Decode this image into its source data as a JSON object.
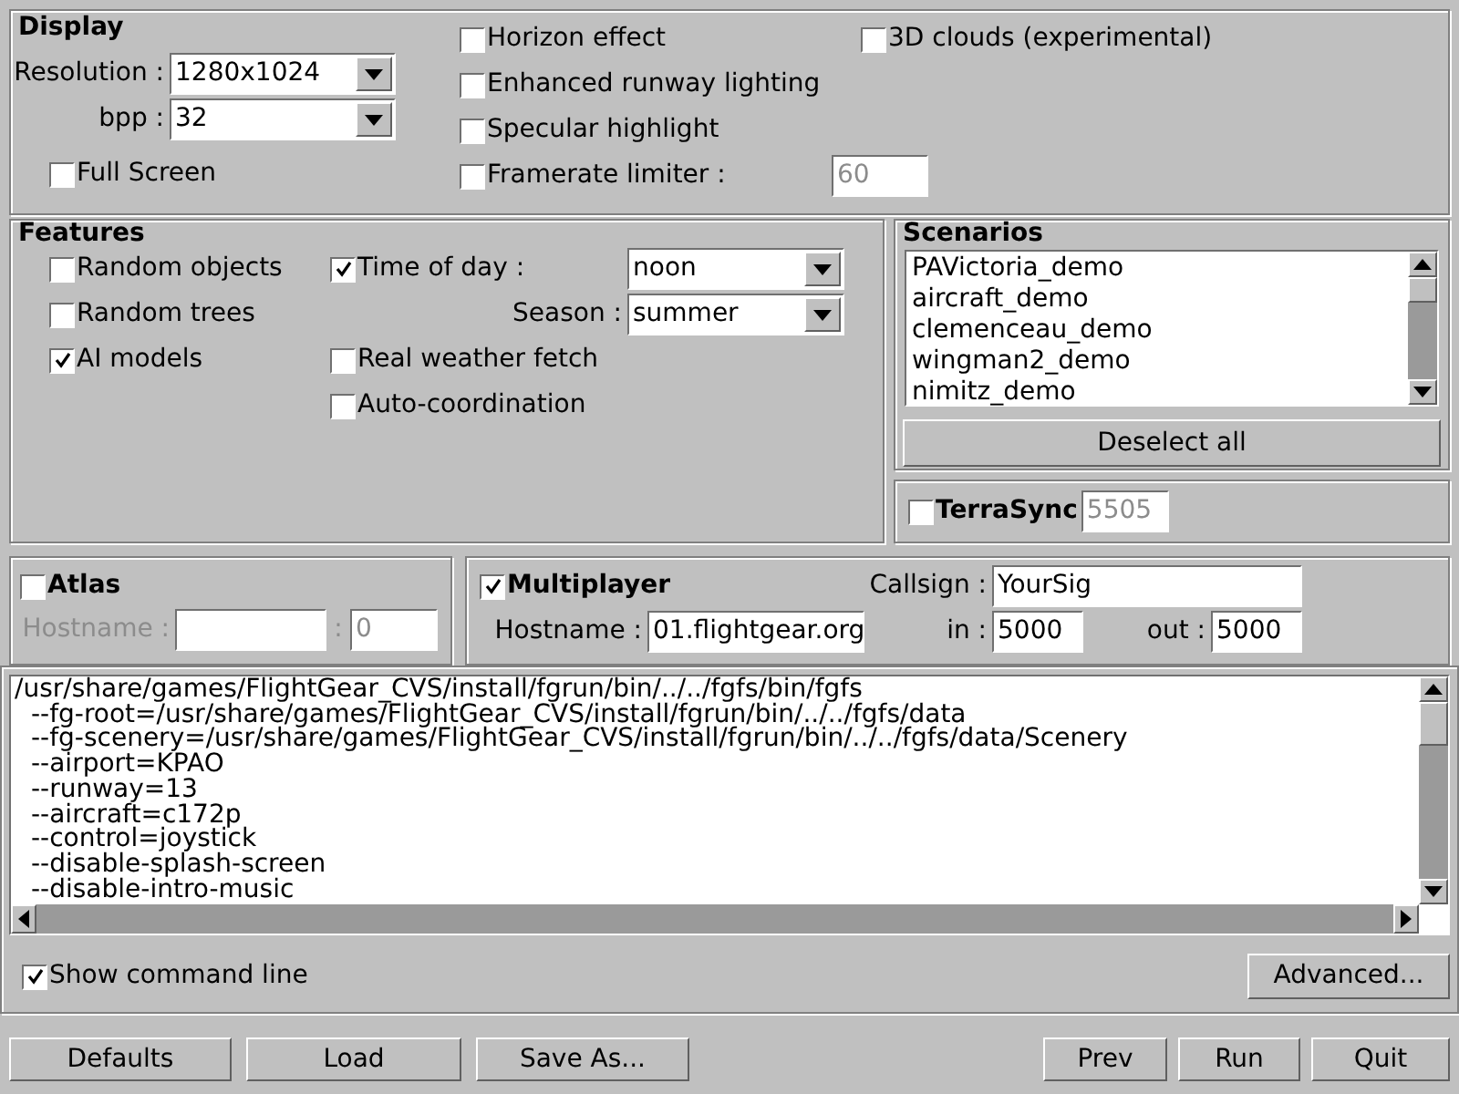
{
  "display": {
    "title": "Display",
    "resolution": {
      "label": "Resolution :",
      "value": "1280x1024"
    },
    "bpp": {
      "label": "bpp :",
      "value": "32"
    },
    "full_screen": {
      "label": "Full Screen",
      "checked": false
    },
    "options": [
      {
        "label": "Horizon effect",
        "checked": false
      },
      {
        "label": "Enhanced runway lighting",
        "checked": false
      },
      {
        "label": "Specular highlight",
        "checked": false
      }
    ],
    "framerate_limiter": {
      "label": "Framerate limiter :",
      "checked": false,
      "value": "60",
      "disabled": true
    },
    "clouds_3d": {
      "label": "3D clouds (experimental)",
      "checked": false
    }
  },
  "features": {
    "title": "Features",
    "options": [
      {
        "label": "Random objects",
        "checked": false
      },
      {
        "label": "Random trees",
        "checked": false
      },
      {
        "label": "AI models",
        "checked": true
      }
    ],
    "time_of_day": {
      "label": "Time of day :",
      "checked": true,
      "value": "noon"
    },
    "season": {
      "label": "Season :",
      "value": "summer"
    },
    "extra_options": [
      {
        "label": "Real weather fetch",
        "checked": false
      },
      {
        "label": "Auto-coordination",
        "checked": false
      }
    ]
  },
  "scenarios": {
    "title": "Scenarios",
    "items": [
      {
        "label": "PAVictoria_demo",
        "selected": false
      },
      {
        "label": "aircraft_demo",
        "selected": false
      },
      {
        "label": "clemenceau_demo",
        "selected": false
      },
      {
        "label": "wingman2_demo",
        "selected": false
      },
      {
        "label": "nimitz_demo",
        "selected": false
      }
    ],
    "button": "Deselect all"
  },
  "terrasync": {
    "label": "TerraSync",
    "checked": false,
    "port": "5505",
    "disabled": true
  },
  "atlas": {
    "label": "Atlas",
    "checked": false,
    "hostname_label": "Hostname :",
    "separator": ":",
    "port": "0",
    "disabled": true
  },
  "multiplayer": {
    "label": "Multiplayer",
    "checked": true,
    "callsign_label": "Callsign :",
    "callsign": "YourSig",
    "hostname_label": "Hostname :",
    "hostname": "01.flightgear.org",
    "in_label": "in :",
    "in_port": "5000",
    "out_label": "out :",
    "out_port": "5000"
  },
  "command_line": {
    "command": "/usr/share/games/FlightGear_CVS/install/fgrun/bin/../../fgfs/bin/fgfs",
    "arguments": [
      "--fg-root=/usr/share/games/FlightGear_CVS/install/fgrun/bin/../../fgfs/data",
      "--fg-scenery=/usr/share/games/FlightGear_CVS/install/fgrun/bin/../../fgfs/data/Scenery",
      "--airport=KPAO",
      "--runway=13",
      "--aircraft=c172p",
      "--control=joystick",
      "--disable-splash-screen",
      "--disable-intro-music"
    ]
  },
  "show_command_line": {
    "label": "Show command line",
    "checked": true
  },
  "advanced_button": "Advanced...",
  "buttons_left": [
    "Defaults",
    "Load",
    "Save As..."
  ],
  "buttons_right": [
    "Prev",
    "Run",
    "Quit"
  ]
}
